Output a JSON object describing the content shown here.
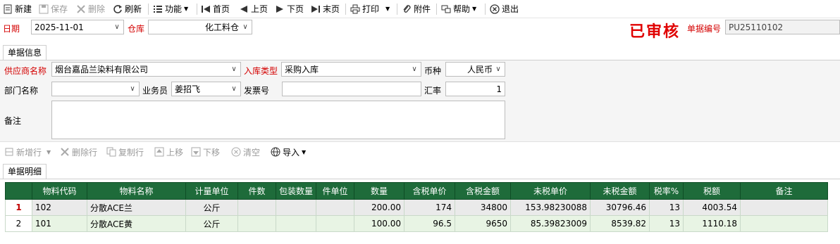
{
  "toolbar": {
    "new": "新建",
    "save": "保存",
    "delete": "删除",
    "refresh": "刷新",
    "function": "功能",
    "first": "首页",
    "prev": "上页",
    "next": "下页",
    "last": "末页",
    "print": "打印",
    "attachment": "附件",
    "help": "帮助",
    "exit": "退出"
  },
  "header": {
    "date_label": "日期",
    "date_value": "2025-11-01",
    "warehouse_label": "仓库",
    "warehouse_value": "化工料仓",
    "status_stamp": "已审核",
    "doc_no_label": "单据编号",
    "doc_no_value": "PU25110102"
  },
  "doc_info": {
    "tab_label": "单据信息",
    "supplier_label": "供应商名称",
    "supplier_value": "烟台嘉品兰染料有限公司",
    "inbound_type_label": "入库类型",
    "inbound_type_value": "采购入库",
    "currency_label": "币种",
    "currency_value": "人民币",
    "dept_label": "部门名称",
    "dept_value": "",
    "salesman_label": "业务员",
    "salesman_value": "姜招飞",
    "invoice_label": "发票号",
    "invoice_value": "",
    "rate_label": "汇率",
    "rate_value": "1",
    "remark_label": "备注",
    "remark_value": ""
  },
  "grid_toolbar": {
    "add_row": "新增行",
    "delete_row": "删除行",
    "copy_row": "复制行",
    "move_up": "上移",
    "move_down": "下移",
    "clear": "清空",
    "import": "导入"
  },
  "detail": {
    "tab_label": "单据明细",
    "columns": [
      "物料代码",
      "物料名称",
      "计量单位",
      "件数",
      "包装数量",
      "件单位",
      "数量",
      "含税单价",
      "含税金额",
      "未税单价",
      "未税金额",
      "税率%",
      "税额",
      "备注"
    ],
    "rows": [
      {
        "idx": "1",
        "code": "102",
        "name": "分散ACE兰",
        "unit": "公斤",
        "pieces": "",
        "pack_qty": "",
        "piece_unit": "",
        "qty": "200.00",
        "tax_price": "174",
        "tax_amount": "34800",
        "net_price": "153.98230088",
        "net_amount": "30796.46",
        "tax_rate": "13",
        "tax": "4003.54",
        "remark": ""
      },
      {
        "idx": "2",
        "code": "101",
        "name": "分散ACE黄",
        "unit": "公斤",
        "pieces": "",
        "pack_qty": "",
        "piece_unit": "",
        "qty": "100.00",
        "tax_price": "96.5",
        "tax_amount": "9650",
        "net_price": "85.39823009",
        "net_amount": "8539.82",
        "tax_rate": "13",
        "tax": "1110.18",
        "remark": ""
      }
    ]
  },
  "colors": {
    "header_green": "#1e6b3a",
    "required_red": "#d40000",
    "stamp_red": "#e00000"
  }
}
